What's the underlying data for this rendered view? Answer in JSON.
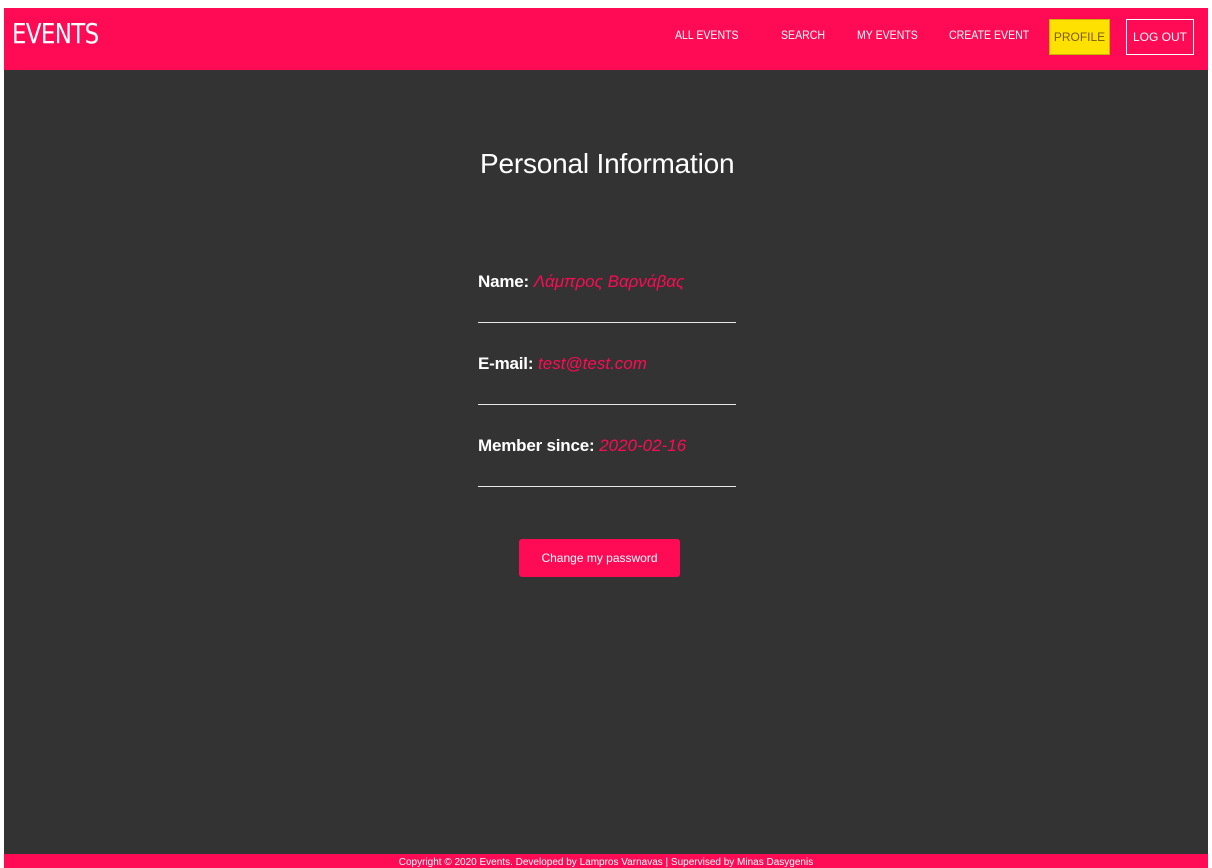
{
  "header": {
    "brand": "EVENTS",
    "nav": {
      "all_events": "ALL EVENTS",
      "search": "SEARCH",
      "my_events": "MY EVENTS",
      "create_event": "CREATE EVENT",
      "profile": "PROFILE",
      "log_out": "LOG OUT"
    }
  },
  "profile": {
    "title": "Personal Information",
    "fields": [
      {
        "label": "Name:",
        "value": "Λάμπρος Βαρνάβας"
      },
      {
        "label": "E-mail:",
        "value": "test@test.com"
      },
      {
        "label": "Member since:",
        "value": "2020-02-16"
      }
    ],
    "action_label": "Change my password"
  },
  "footer": {
    "text": "Copyright © 2020 Events. Developed by Lampros Varnavas | Supervised by Minas Dasygenis"
  },
  "colors": {
    "accent": "#ff0a54",
    "active_nav": "#ffe100",
    "page_background": "#333333",
    "text_on_dark": "#ffffff"
  }
}
